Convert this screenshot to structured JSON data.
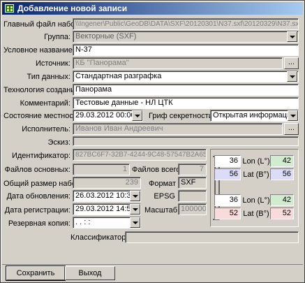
{
  "window": {
    "title": "Добавление новой записи"
  },
  "labels": {
    "main_file": "Главный файл набора:",
    "group": "Группа:",
    "conditional_name": "Условное название:",
    "source": "Источник:",
    "data_type": "Тип данных:",
    "technology": "Технология создания:",
    "comment": "Комментарий:",
    "terrain_state": "Состояние местности:",
    "secrecy": "Гриф секретности:",
    "executor": "Исполнитель:",
    "sketch": "Эскиз:",
    "identifier": "Идентификатор:",
    "files_main": "Файлов основных:",
    "files_total": "Файлов всего:",
    "total_size": "Общий размер набора:",
    "format": "Формат",
    "update_date": "Дата обновления:",
    "epsg": "EPSG",
    "reg_date": "Дата регистрации:",
    "scale": "Масштаб",
    "backup": "Резервная копия:",
    "classifier": "Классификатор:"
  },
  "values": {
    "main_file": "\\\\Ingener\\Public\\GeoDB\\DATA\\SXF\\20120301\\N37.sxf\\20120329\\N37.sxf",
    "group": "Векторные (SXF)",
    "conditional_name": "N-37",
    "source": "КБ \"Панорама\"",
    "data_type": "Стандартная разграфка",
    "technology": "Панорама",
    "comment": "Тестовые данные - НЛ ЦТК",
    "terrain_state": "29.03.2012 00:00:00",
    "secrecy": "Открытая информация",
    "executor": "Иванов Иван Андреевич",
    "identifier": "827BC6F7-32B7-4244-9C48-57547B2A657F",
    "files_main": "1",
    "files_total": "7",
    "total_size": "239",
    "format": "SXF",
    "update_date": "26.03.2012 10:30:52",
    "epsg": "",
    "reg_date": "29.03.2012 14:57:05",
    "scale": "1000000",
    "backup": ".  .       :  :",
    "classifier": ""
  },
  "coords": {
    "top": {
      "lon_deg": "36",
      "lon_label": "Lon (L°)",
      "lon_val": "42",
      "lat_deg": "56",
      "lat_label": "Lat (B°)",
      "lat_val": "56"
    },
    "bottom": {
      "lon_deg": "36",
      "lon_label": "Lon (L°)",
      "lon_val": "42",
      "lat_deg": "52",
      "lat_label": "Lat (B°)",
      "lat_val": "52"
    }
  },
  "buttons": {
    "browse": "...",
    "save": "Сохранить",
    "exit": "Выход"
  },
  "icons": {
    "app": "app-icon",
    "dropdown": "chevron-down-icon"
  }
}
